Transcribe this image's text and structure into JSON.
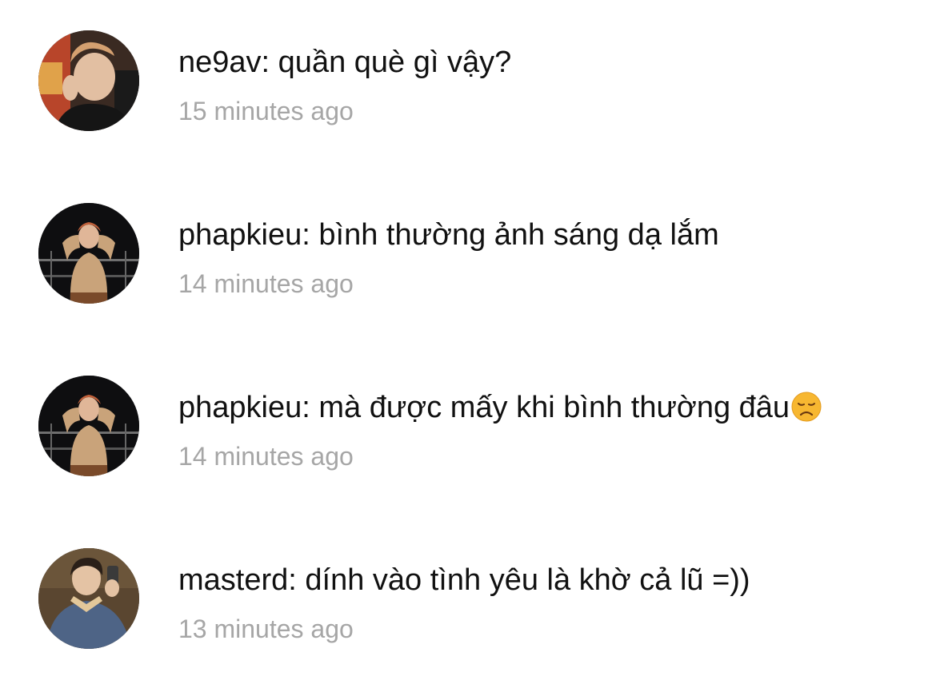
{
  "comments": [
    {
      "username": "ne9av",
      "message": "quần què gì vậy?",
      "time": "15 minutes ago"
    },
    {
      "username": "phapkieu",
      "message": "bình thường ảnh sáng dạ lắm",
      "time": "14 minutes ago"
    },
    {
      "username": "phapkieu",
      "message": "mà được mấy khi bình thường đâu",
      "emoji": "disappointed-face",
      "time": "14 minutes ago"
    },
    {
      "username": "masterd",
      "message": "dính vào tình yêu là khờ cả lũ =))",
      "time": "13 minutes ago"
    }
  ],
  "colors": {
    "text": "#111111",
    "timestamp": "#a6a6a6",
    "emoji": "#f7b731"
  }
}
